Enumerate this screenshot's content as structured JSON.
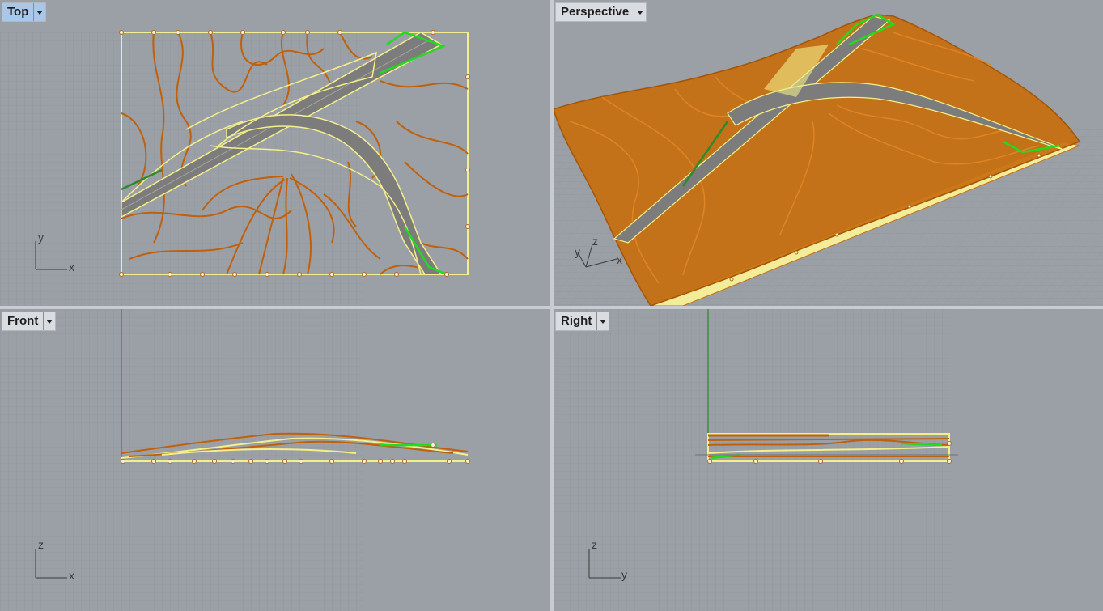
{
  "viewports": {
    "top": {
      "title": "Top",
      "axes": {
        "a": "y",
        "b": "x"
      }
    },
    "perspective": {
      "title": "Perspective",
      "axes": {
        "a": "z",
        "b": "y",
        "c": "x"
      }
    },
    "front": {
      "title": "Front",
      "axes": {
        "a": "z",
        "b": "x"
      }
    },
    "right": {
      "title": "Right",
      "axes": {
        "a": "z",
        "b": "y"
      }
    }
  },
  "active_viewport": "Top",
  "colors": {
    "viewport_bg": "#9ba0a6",
    "grid_minor": "#8f949a",
    "grid_major": "#84898f",
    "contour": "#c0600a",
    "selection": "#f4ef8a",
    "road": "#7c7c7c",
    "accent_green": "#1fdc1f",
    "terrain_fill": "#c76e0e",
    "terrain_side": "#f3ec98"
  }
}
